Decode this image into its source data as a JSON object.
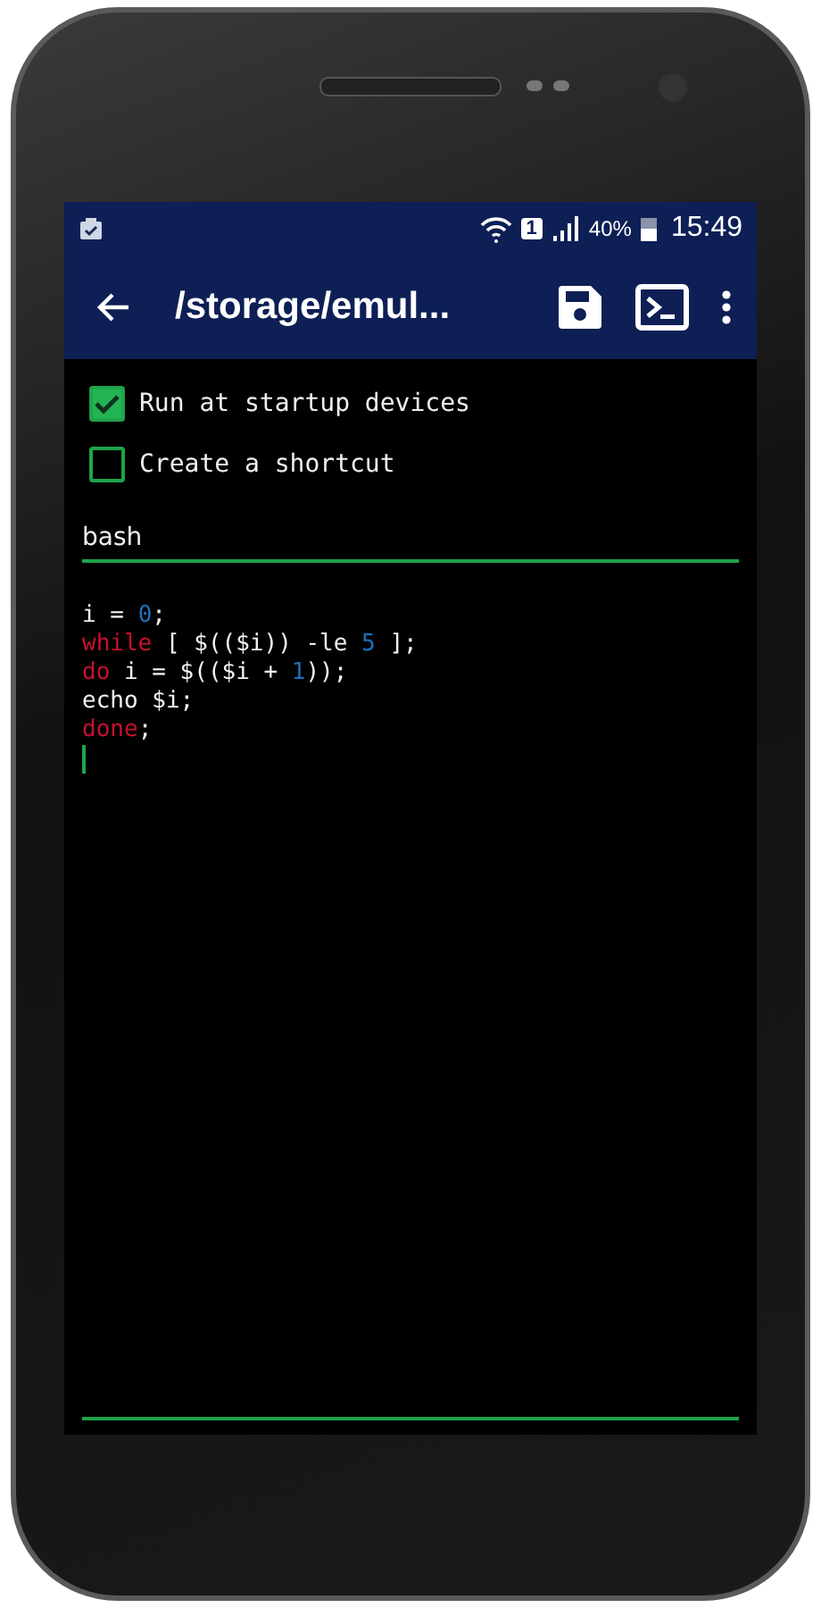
{
  "status_bar": {
    "battery": "40%",
    "time": "15:49",
    "sim": "1"
  },
  "toolbar": {
    "title": "/storage/emul..."
  },
  "options": [
    {
      "label": "Run at startup devices",
      "checked": true
    },
    {
      "label": "Create a shortcut",
      "checked": false
    }
  ],
  "shell_field": {
    "value": "bash"
  },
  "code": [
    [
      {
        "kind": "plain",
        "text": "i = "
      },
      {
        "kind": "number",
        "text": "0"
      },
      {
        "kind": "plain",
        "text": ";"
      }
    ],
    [
      {
        "kind": "keyword",
        "text": "while"
      },
      {
        "kind": "plain",
        "text": " [ $(($i)) -le "
      },
      {
        "kind": "number",
        "text": "5"
      },
      {
        "kind": "plain",
        "text": " ];"
      }
    ],
    [
      {
        "kind": "keyword",
        "text": "do"
      },
      {
        "kind": "plain",
        "text": " i = $(($i + "
      },
      {
        "kind": "number",
        "text": "1"
      },
      {
        "kind": "plain",
        "text": "));"
      }
    ],
    [
      {
        "kind": "plain",
        "text": "echo $i;"
      }
    ],
    [
      {
        "kind": "keyword",
        "text": "done"
      },
      {
        "kind": "plain",
        "text": ";"
      }
    ]
  ]
}
